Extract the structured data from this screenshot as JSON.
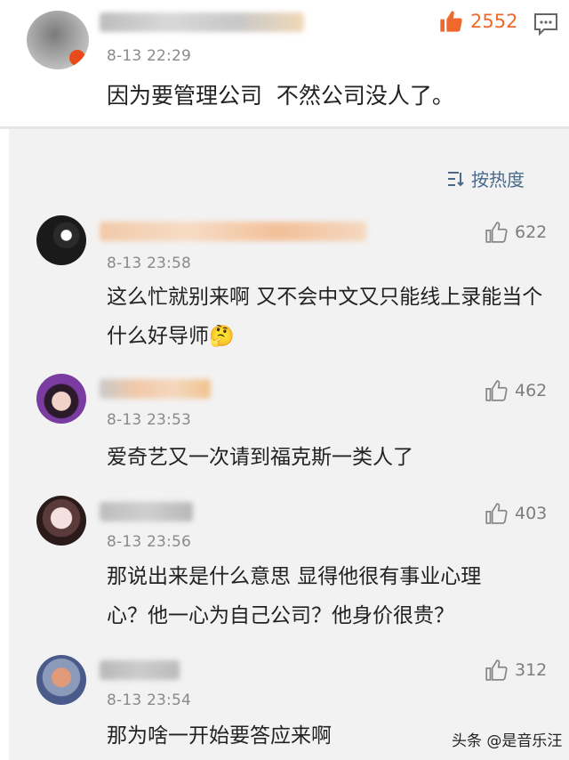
{
  "main_comment": {
    "time": "8-13 22:29",
    "text": "因为要管理公司  不然公司没人了。",
    "likes": "2552"
  },
  "sort_label": "按热度",
  "replies": [
    {
      "time": "8-13 23:58",
      "text": "这么忙就别来啊  又不会中文又只能线上录能当个什么好导师",
      "emoji": "🤔",
      "likes": "622"
    },
    {
      "time": "8-13 23:53",
      "text": "爱奇艺又一次请到福克斯一类人了",
      "likes": "462"
    },
    {
      "time": "8-13 23:56",
      "text": "那说出来是什么意思 显得他很有事业心理心？他一心为自己公司？他身价很贵？",
      "likes": "403"
    },
    {
      "time": "8-13 23:54",
      "text": "那为啥一开始要答应来啊",
      "likes": "312"
    }
  ],
  "watermark": "头条 @是音乐汪",
  "colors": {
    "like_active": "#f0692c",
    "sort_text": "#4a6a8a",
    "sub_bg": "#f2f2f2"
  }
}
